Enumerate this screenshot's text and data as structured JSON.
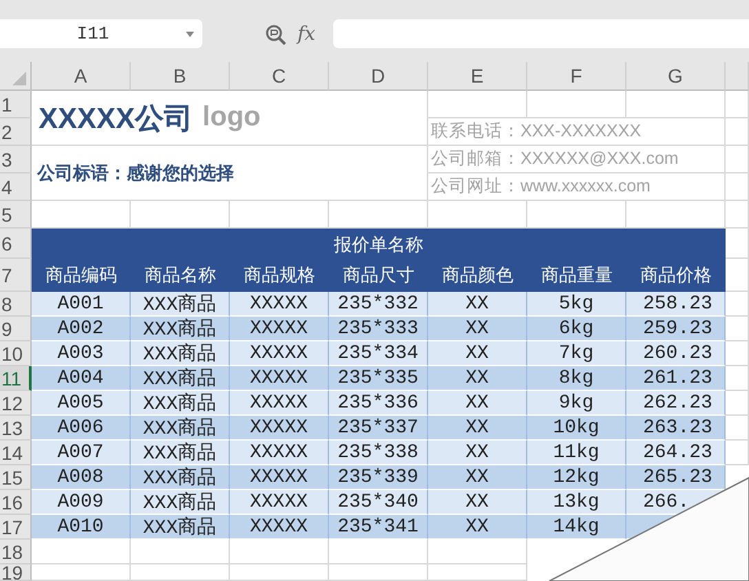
{
  "formula_bar": {
    "name_box": "I11",
    "fx_label": "fx"
  },
  "column_headers": [
    "A",
    "B",
    "C",
    "D",
    "E",
    "F",
    "G"
  ],
  "row_headers": [
    {
      "label": "1",
      "selected": false
    },
    {
      "label": "2",
      "selected": false
    },
    {
      "label": "3",
      "selected": false
    },
    {
      "label": "4",
      "selected": false
    },
    {
      "label": "5",
      "selected": false
    },
    {
      "label": "6",
      "selected": false
    },
    {
      "label": "7",
      "selected": false
    },
    {
      "label": "8",
      "selected": false
    },
    {
      "label": "9",
      "selected": false
    },
    {
      "label": "10",
      "selected": false
    },
    {
      "label": "11",
      "selected": true
    },
    {
      "label": "12",
      "selected": false
    },
    {
      "label": "13",
      "selected": false
    },
    {
      "label": "14",
      "selected": false
    },
    {
      "label": "15",
      "selected": false
    },
    {
      "label": "16",
      "selected": false
    },
    {
      "label": "17",
      "selected": false
    },
    {
      "label": "18",
      "selected": false
    },
    {
      "label": "19",
      "selected": false
    }
  ],
  "company": {
    "name": "XXXXX公司",
    "logo": "logo"
  },
  "slogan": "公司标语：感谢您的选择",
  "contacts": [
    "联系电话：XXX-XXXXXXX",
    "公司邮箱：XXXXXX@XXX.com",
    "公司网址：www.xxxxxx.com"
  ],
  "quote_table": {
    "title": "报价单名称",
    "headers": [
      "商品编码",
      "商品名称",
      "商品规格",
      "商品尺寸",
      "商品颜色",
      "商品重量",
      "商品价格"
    ],
    "rows": [
      {
        "cells": [
          "A001",
          "XXX商品",
          "XXXXX",
          "235*332",
          "XX",
          "5kg",
          "258.23"
        ]
      },
      {
        "cells": [
          "A002",
          "XXX商品",
          "XXXXX",
          "235*333",
          "XX",
          "6kg",
          "259.23"
        ]
      },
      {
        "cells": [
          "A003",
          "XXX商品",
          "XXXXX",
          "235*334",
          "XX",
          "7kg",
          "260.23"
        ]
      },
      {
        "cells": [
          "A004",
          "XXX商品",
          "XXXXX",
          "235*335",
          "XX",
          "8kg",
          "261.23"
        ]
      },
      {
        "cells": [
          "A005",
          "XXX商品",
          "XXXXX",
          "235*336",
          "XX",
          "9kg",
          "262.23"
        ]
      },
      {
        "cells": [
          "A006",
          "XXX商品",
          "XXXXX",
          "235*337",
          "XX",
          "10kg",
          "263.23"
        ]
      },
      {
        "cells": [
          "A007",
          "XXX商品",
          "XXXXX",
          "235*338",
          "XX",
          "11kg",
          "264.23"
        ]
      },
      {
        "cells": [
          "A008",
          "XXX商品",
          "XXXXX",
          "235*339",
          "XX",
          "12kg",
          "265.23"
        ]
      },
      {
        "cells": [
          "A009",
          "XXX商品",
          "XXXXX",
          "235*340",
          "XX",
          "13kg",
          "266."
        ]
      },
      {
        "cells": [
          "A010",
          "XXX商品",
          "XXXXX",
          "235*341",
          "XX",
          "14kg"
        ]
      }
    ]
  }
}
